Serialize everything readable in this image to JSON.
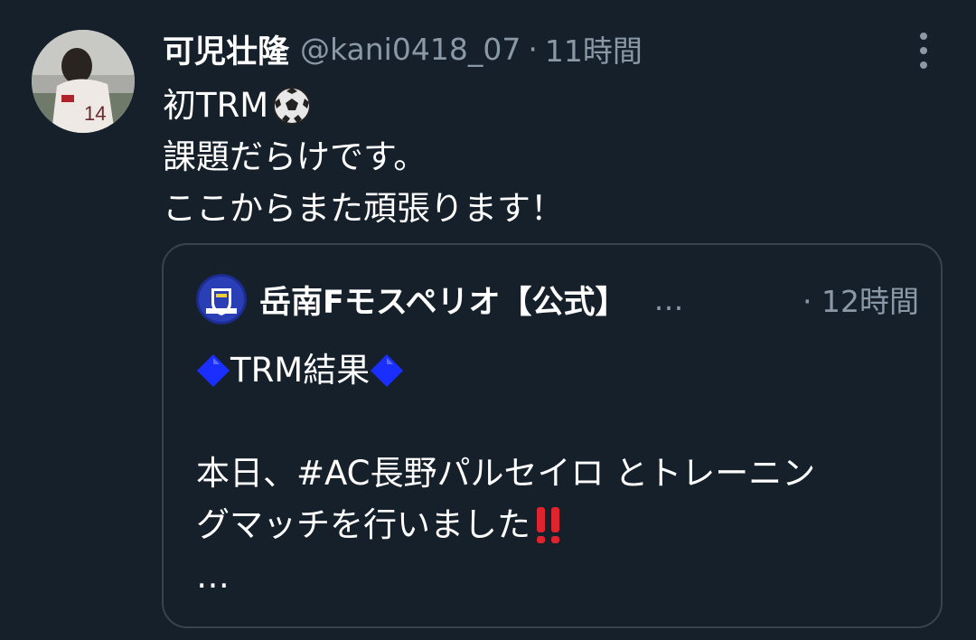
{
  "tweet": {
    "display_name": "可児壮隆",
    "handle": "@kani0418_07",
    "separator": "·",
    "time": "11時間",
    "avatar_icon": "profile-photo",
    "menu_icon": "more-vertical-icon",
    "lines": [
      "初TRM",
      "課題だらけです。",
      "ここからまた頑張ります！"
    ],
    "emoji": "soccer-ball"
  },
  "quote": {
    "display_name": "岳南Fモスペリオ【公式】",
    "truncation": "…",
    "separator": "·",
    "time": "12時間",
    "logo_icon": "club-crest",
    "heading": "TRM結果",
    "body_line1": "本日、#AC長野パルセイロ とトレーニン",
    "body_line2": "グマッチを行いました",
    "more": "…",
    "colors": {
      "diamond": "#1a2fff",
      "bang": "#e0242f"
    }
  },
  "colors": {
    "background": "#15202b",
    "muted": "#8b98a5",
    "border": "#38444d"
  }
}
